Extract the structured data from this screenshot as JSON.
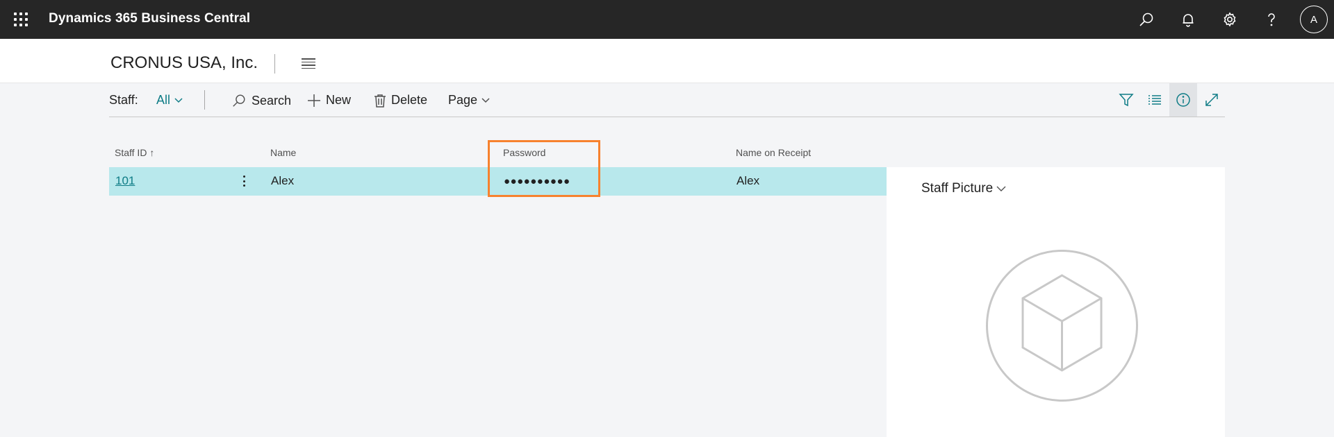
{
  "app": {
    "title": "Dynamics 365 Business Central",
    "user_initial": "A"
  },
  "header": {
    "company": "CRONUS USA, Inc."
  },
  "actionbar": {
    "staff_label": "Staff:",
    "filter_value": "All",
    "search_label": "Search",
    "new_label": "New",
    "delete_label": "Delete",
    "page_label": "Page"
  },
  "table": {
    "columns": [
      "Staff ID",
      "Name",
      "Password",
      "Name on Receipt"
    ],
    "sort_indicator": "↑",
    "rows": [
      {
        "staff_id": "101",
        "name": "Alex",
        "password": "●●●●●●●●●●",
        "name_on_receipt": "Alex"
      }
    ]
  },
  "factbox": {
    "title": "Staff Picture"
  },
  "colors": {
    "accent": "#0e7c86",
    "selected_row": "#b8e8ec",
    "highlight": "#f7822e",
    "topbar": "#262626"
  }
}
